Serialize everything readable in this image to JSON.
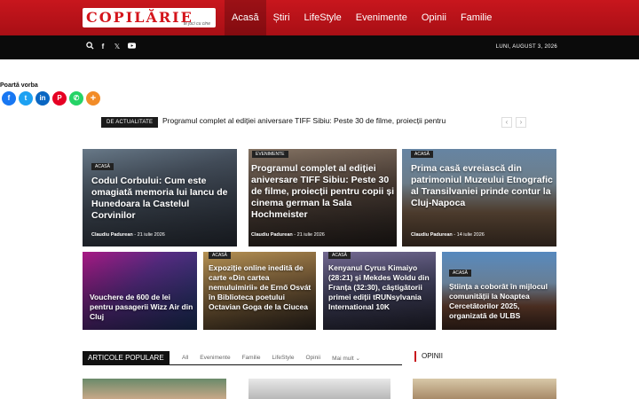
{
  "header": {
    "logo_text": "COPILĂRIE",
    "logo_tagline": "te joci cu cine",
    "nav": [
      "Acasă",
      "Știri",
      "LifeStyle",
      "Evenimente",
      "Opinii",
      "Familie"
    ]
  },
  "topbar": {
    "date": "LUNI, AUGUST 3, 2026"
  },
  "share": {
    "title": "Poartă vorba",
    "networks": [
      "facebook",
      "twitter",
      "linkedin",
      "pinterest",
      "whatsapp",
      "more"
    ]
  },
  "ticker": {
    "badge": "DE ACTUALITATE",
    "text": "Programul complet al ediției aniversare TIFF Sibiu: Peste 30 de filme, proiecții pentru copii și"
  },
  "featured": [
    {
      "category": "ACASĂ",
      "title": "Codul Corbului: Cum este omagiată memoria lui Iancu de Hunedoara la Castelul Corvinilor",
      "author": "Claudiu Padurean",
      "date": "21 iulie 2026"
    },
    {
      "category": "EVENIMENTE",
      "title": "Programul complet al ediției aniversare TIFF Sibiu: Peste 30 de filme, proiecții pentru copii și cinema german la Sala Hochmeister",
      "author": "Claudiu Padurean",
      "date": "21 iulie 2026"
    },
    {
      "category": "ACASĂ",
      "title": "Prima casă evreiască din patrimoniul Muzeului Etnografic al Transilvaniei prinde contur la Cluj-Napoca",
      "author": "Claudiu Padurean",
      "date": "14 iulie 2026"
    }
  ],
  "secondary": [
    {
      "category": "ACASĂ",
      "title": "Vouchere de 600 de lei pentru pasagerii Wizz Air din Cluj"
    },
    {
      "category": "ACASĂ",
      "title": "Expoziție online inedită de carte «Din cartea nemuluimirii» de Ernő Osvát în Biblioteca poetului Octavian Goga de la Ciucea"
    },
    {
      "category": "ACASĂ",
      "title": "Kenyanul Cyrus Kimaiyo (28:21) și Mekdes Woldu din Franța (32:30), câștigătorii primei ediții tRUNsylvania International 10K"
    },
    {
      "category": "ACASĂ",
      "title": "Știința a coborât în mijlocul comunității la Noaptea Cercetătorilor 2025, organizată de ULBS"
    }
  ],
  "popular": {
    "title": "ARTICOLE POPULARE",
    "filters": [
      "All",
      "Evenimente",
      "Familie",
      "LifeStyle",
      "Opinii",
      "Mai mult ⌄"
    ]
  },
  "opinii": {
    "title": "OPINII"
  },
  "colors": {
    "brand_red": "#c8161d",
    "dark": "#0b0b0b"
  }
}
